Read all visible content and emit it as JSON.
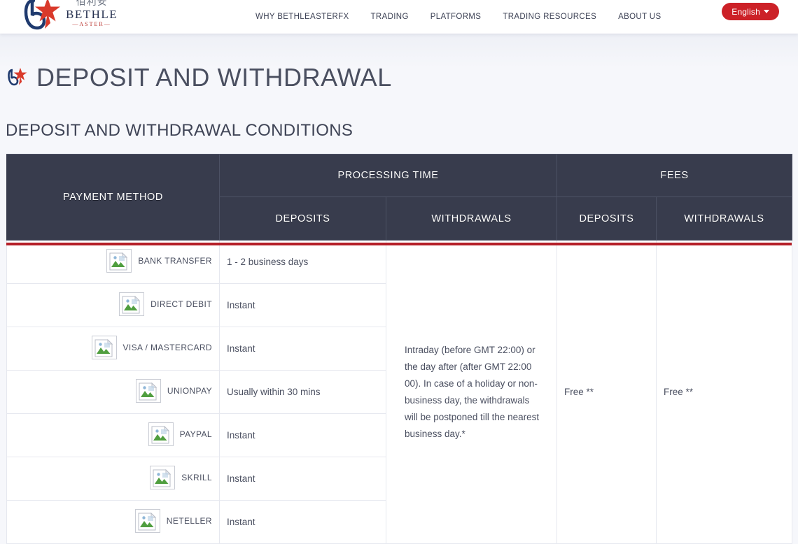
{
  "nav": {
    "brand": {
      "chinese": "佰利安",
      "name": "BETHLE",
      "subtitle": "—ASTER—",
      "logo_icon": "bethleaster-logo-icon"
    },
    "links": [
      {
        "label": "WHY BETHLEASTERFX"
      },
      {
        "label": "TRADING"
      },
      {
        "label": "PLATFORMS"
      },
      {
        "label": "TRADING RESOURCES"
      },
      {
        "label": "ABOUT US"
      }
    ],
    "language": {
      "label": "English",
      "caret_icon": "chevron-down-icon"
    }
  },
  "hero": {
    "title": "DEPOSIT AND WITHDRAWAL",
    "mark_icon": "bethleaster-mark-icon"
  },
  "section": {
    "title": "DEPOSIT AND WITHDRAWAL CONDITIONS"
  },
  "table": {
    "header": {
      "payment_method": "PAYMENT METHOD",
      "processing_time": "PROCESSING TIME",
      "fees": "FEES",
      "processing_deposits": "DEPOSITS",
      "processing_withdrawals": "WITHDRAWALS",
      "fees_deposits": "DEPOSITS",
      "fees_withdrawals": "WITHDRAWALS"
    },
    "rows": [
      {
        "method": "BANK TRANSFER",
        "icon": "broken-image-icon",
        "deposit_time": "1 - 2 business days"
      },
      {
        "method": "DIRECT DEBIT",
        "icon": "broken-image-icon",
        "deposit_time": "Instant"
      },
      {
        "method": "VISA / MASTERCARD",
        "icon": "broken-image-icon",
        "deposit_time": "Instant"
      },
      {
        "method": "UNIONPAY",
        "icon": "broken-image-icon",
        "deposit_time": "Usually within 30 mins"
      },
      {
        "method": "PAYPAL",
        "icon": "broken-image-icon",
        "deposit_time": "Instant"
      },
      {
        "method": "SKRILL",
        "icon": "broken-image-icon",
        "deposit_time": "Instant"
      },
      {
        "method": "NETELLER",
        "icon": "broken-image-icon",
        "deposit_time": "Instant"
      }
    ],
    "withdrawal_note": "Intraday (before GMT 22:00) or the day after (after GMT 22:00 00). In case of a holiday or non-business day, the withdrawals will be postponed till the nearest business day.*",
    "fees_deposits_value": "Free **",
    "fees_withdrawals_value": "Free **"
  },
  "colors": {
    "brand_red": "#cc2127",
    "header_navy": "#383c4d",
    "header_underline": "#b51f28",
    "page_bg": "#f6f7fb"
  }
}
